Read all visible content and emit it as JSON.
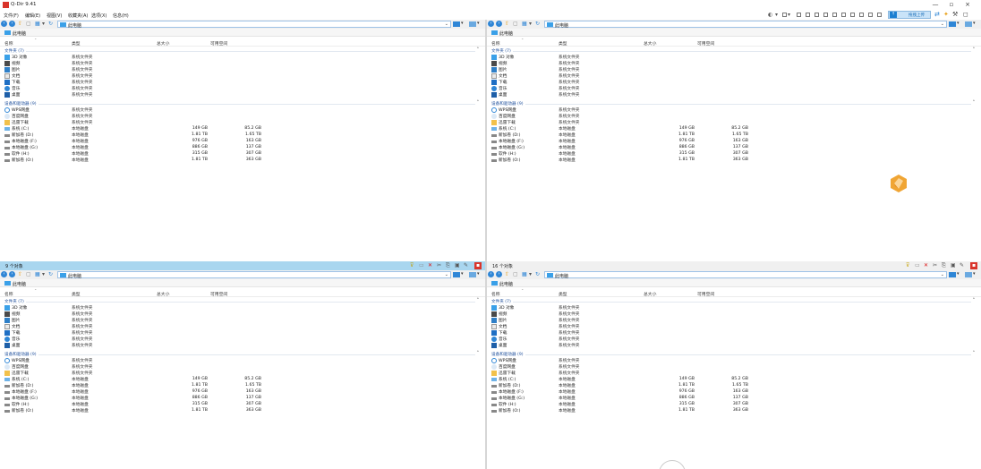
{
  "app": {
    "title": "Q-Dir 9.41"
  },
  "menu": [
    "文件(F)",
    "编辑(E)",
    "视图(V)",
    "收藏夹(A)",
    "选项(X)",
    "信息(H)"
  ],
  "window_controls": {
    "minimize": "—",
    "maximize": "▫",
    "close": "×"
  },
  "toolbar_right": {
    "upload_label": "拖拽上传"
  },
  "columns": {
    "name": "名称",
    "type": "类型",
    "total": "总大小",
    "free": "可用空间"
  },
  "panes": [
    {
      "id": "top-left",
      "address": "此电脑",
      "crumb": "此电脑",
      "status": "9 个对象",
      "active": true,
      "folders_header": "文件夹 (7)",
      "drives_header": "设备和驱动器 (9)",
      "folders": [
        {
          "name": "3D 对象",
          "type": "系统文件夹",
          "icon": "3d-objects"
        },
        {
          "name": "视频",
          "type": "系统文件夹",
          "icon": "video"
        },
        {
          "name": "图片",
          "type": "系统文件夹",
          "icon": "pictures"
        },
        {
          "name": "文档",
          "type": "系统文件夹",
          "icon": "documents"
        },
        {
          "name": "下载",
          "type": "系统文件夹",
          "icon": "downloads"
        },
        {
          "name": "音乐",
          "type": "系统文件夹",
          "icon": "music"
        },
        {
          "name": "桌面",
          "type": "系统文件夹",
          "icon": "desktop"
        }
      ],
      "drives": [
        {
          "name": "WPS网盘",
          "type": "系统文件夹",
          "total": "",
          "free": "",
          "icon": "wps-cloud"
        },
        {
          "name": "百度网盘",
          "type": "系统文件夹",
          "total": "",
          "free": "",
          "icon": "baidu-cloud"
        },
        {
          "name": "迅雷下载",
          "type": "系统文件夹",
          "total": "",
          "free": "",
          "icon": "xunlei"
        },
        {
          "name": "系统 (C:)",
          "type": "本地磁盘",
          "total": "149 GB",
          "free": "85.2 GB",
          "icon": "system-drive"
        },
        {
          "name": "新加卷 (D:)",
          "type": "本地磁盘",
          "total": "1.81 TB",
          "free": "1.65 TB",
          "icon": "drive"
        },
        {
          "name": "本地磁盘 (F:)",
          "type": "本地磁盘",
          "total": "976 GB",
          "free": "163 GB",
          "icon": "drive"
        },
        {
          "name": "本地磁盘 (G:)",
          "type": "本地磁盘",
          "total": "886 GB",
          "free": "137 GB",
          "icon": "drive"
        },
        {
          "name": "软件 (H:)",
          "type": "本地磁盘",
          "total": "315 GB",
          "free": "307 GB",
          "icon": "drive"
        },
        {
          "name": "新加卷 (O:)",
          "type": "本地磁盘",
          "total": "1.81 TB",
          "free": "363 GB",
          "icon": "drive"
        }
      ]
    },
    {
      "id": "top-right",
      "address": "此电脑",
      "crumb": "此电脑",
      "status": "16 个对象",
      "active": false,
      "folders_header": "文件夹 (7)",
      "drives_header": "设备和驱动器 (9)",
      "folders": [
        {
          "name": "3D 对象",
          "type": "系统文件夹",
          "icon": "3d-objects"
        },
        {
          "name": "视频",
          "type": "系统文件夹",
          "icon": "video"
        },
        {
          "name": "图片",
          "type": "系统文件夹",
          "icon": "pictures"
        },
        {
          "name": "文档",
          "type": "系统文件夹",
          "icon": "documents"
        },
        {
          "name": "下载",
          "type": "系统文件夹",
          "icon": "downloads"
        },
        {
          "name": "音乐",
          "type": "系统文件夹",
          "icon": "music"
        },
        {
          "name": "桌面",
          "type": "系统文件夹",
          "icon": "desktop"
        }
      ],
      "drives": [
        {
          "name": "WPS网盘",
          "type": "系统文件夹",
          "total": "",
          "free": "",
          "icon": "wps-cloud"
        },
        {
          "name": "百度网盘",
          "type": "系统文件夹",
          "total": "",
          "free": "",
          "icon": "baidu-cloud"
        },
        {
          "name": "迅雷下载",
          "type": "系统文件夹",
          "total": "",
          "free": "",
          "icon": "xunlei"
        },
        {
          "name": "系统 (C:)",
          "type": "本地磁盘",
          "total": "149 GB",
          "free": "85.2 GB",
          "icon": "system-drive"
        },
        {
          "name": "新加卷 (D:)",
          "type": "本地磁盘",
          "total": "1.81 TB",
          "free": "1.65 TB",
          "icon": "drive"
        },
        {
          "name": "本地磁盘 (F:)",
          "type": "本地磁盘",
          "total": "976 GB",
          "free": "163 GB",
          "icon": "drive"
        },
        {
          "name": "本地磁盘 (G:)",
          "type": "本地磁盘",
          "total": "886 GB",
          "free": "137 GB",
          "icon": "drive"
        },
        {
          "name": "软件 (H:)",
          "type": "本地磁盘",
          "total": "315 GB",
          "free": "307 GB",
          "icon": "drive"
        },
        {
          "name": "新加卷 (O:)",
          "type": "本地磁盘",
          "total": "1.81 TB",
          "free": "363 GB",
          "icon": "drive"
        }
      ]
    },
    {
      "id": "bottom-left",
      "address": "此电脑",
      "crumb": "此电脑",
      "status": "",
      "active": false,
      "folders_header": "文件夹 (7)",
      "drives_header": "设备和驱动器 (9)",
      "folders": [
        {
          "name": "3D 对象",
          "type": "系统文件夹",
          "icon": "3d-objects"
        },
        {
          "name": "视频",
          "type": "系统文件夹",
          "icon": "video"
        },
        {
          "name": "图片",
          "type": "系统文件夹",
          "icon": "pictures"
        },
        {
          "name": "文档",
          "type": "系统文件夹",
          "icon": "documents"
        },
        {
          "name": "下载",
          "type": "系统文件夹",
          "icon": "downloads"
        },
        {
          "name": "音乐",
          "type": "系统文件夹",
          "icon": "music"
        },
        {
          "name": "桌面",
          "type": "系统文件夹",
          "icon": "desktop"
        }
      ],
      "drives": [
        {
          "name": "WPS网盘",
          "type": "系统文件夹",
          "total": "",
          "free": "",
          "icon": "wps-cloud"
        },
        {
          "name": "百度网盘",
          "type": "系统文件夹",
          "total": "",
          "free": "",
          "icon": "baidu-cloud"
        },
        {
          "name": "迅雷下载",
          "type": "系统文件夹",
          "total": "",
          "free": "",
          "icon": "xunlei"
        },
        {
          "name": "系统 (C:)",
          "type": "本地磁盘",
          "total": "149 GB",
          "free": "85.2 GB",
          "icon": "system-drive"
        },
        {
          "name": "新加卷 (D:)",
          "type": "本地磁盘",
          "total": "1.81 TB",
          "free": "1.65 TB",
          "icon": "drive"
        },
        {
          "name": "本地磁盘 (F:)",
          "type": "本地磁盘",
          "total": "976 GB",
          "free": "163 GB",
          "icon": "drive"
        },
        {
          "name": "本地磁盘 (G:)",
          "type": "本地磁盘",
          "total": "886 GB",
          "free": "137 GB",
          "icon": "drive"
        },
        {
          "name": "软件 (H:)",
          "type": "本地磁盘",
          "total": "315 GB",
          "free": "307 GB",
          "icon": "drive"
        },
        {
          "name": "新加卷 (O:)",
          "type": "本地磁盘",
          "total": "1.81 TB",
          "free": "363 GB",
          "icon": "drive"
        }
      ]
    },
    {
      "id": "bottom-right",
      "address": "此电脑",
      "crumb": "此电脑",
      "status": "",
      "active": false,
      "folders_header": "文件夹 (7)",
      "drives_header": "设备和驱动器 (9)",
      "folders": [
        {
          "name": "3D 对象",
          "type": "系统文件夹",
          "icon": "3d-objects"
        },
        {
          "name": "视频",
          "type": "系统文件夹",
          "icon": "video"
        },
        {
          "name": "图片",
          "type": "系统文件夹",
          "icon": "pictures"
        },
        {
          "name": "文档",
          "type": "系统文件夹",
          "icon": "documents"
        },
        {
          "name": "下载",
          "type": "系统文件夹",
          "icon": "downloads"
        },
        {
          "name": "音乐",
          "type": "系统文件夹",
          "icon": "music"
        },
        {
          "name": "桌面",
          "type": "系统文件夹",
          "icon": "desktop"
        }
      ],
      "drives": [
        {
          "name": "WPS网盘",
          "type": "系统文件夹",
          "total": "",
          "free": "",
          "icon": "wps-cloud"
        },
        {
          "name": "百度网盘",
          "type": "系统文件夹",
          "total": "",
          "free": "",
          "icon": "baidu-cloud"
        },
        {
          "name": "迅雷下载",
          "type": "系统文件夹",
          "total": "",
          "free": "",
          "icon": "xunlei"
        },
        {
          "name": "系统 (C:)",
          "type": "本地磁盘",
          "total": "149 GB",
          "free": "85.2 GB",
          "icon": "system-drive"
        },
        {
          "name": "新加卷 (D:)",
          "type": "本地磁盘",
          "total": "1.81 TB",
          "free": "1.65 TB",
          "icon": "drive"
        },
        {
          "name": "本地磁盘 (F:)",
          "type": "本地磁盘",
          "total": "976 GB",
          "free": "163 GB",
          "icon": "drive"
        },
        {
          "name": "本地磁盘 (G:)",
          "type": "本地磁盘",
          "total": "886 GB",
          "free": "137 GB",
          "icon": "drive"
        },
        {
          "name": "软件 (H:)",
          "type": "本地磁盘",
          "total": "315 GB",
          "free": "307 GB",
          "icon": "drive"
        },
        {
          "name": "新加卷 (O:)",
          "type": "本地磁盘",
          "total": "1.81 TB",
          "free": "363 GB",
          "icon": "drive"
        }
      ]
    }
  ],
  "colors": {
    "accent": "#2f86d6",
    "active_status": "#a9d6ef",
    "group_header": "#1e4f9c",
    "logo_red": "#d9342b",
    "float_logo": "#f0a534"
  }
}
